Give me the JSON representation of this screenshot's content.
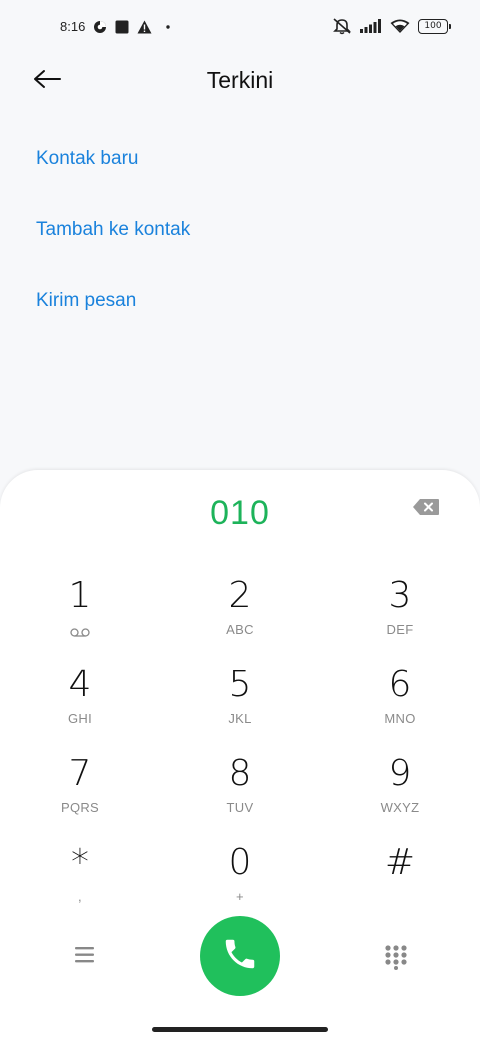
{
  "status_bar": {
    "time": "8:16",
    "battery": "100",
    "icons": [
      "data-saver-icon",
      "square-notification-icon",
      "warning-icon",
      "dot-icon",
      "muted-icon",
      "signal-icon",
      "wifi-icon",
      "battery-icon"
    ]
  },
  "header": {
    "title": "Terkini",
    "back_icon": "arrow-left-icon"
  },
  "actions": [
    {
      "label": "Kontak baru"
    },
    {
      "label": "Tambah ke kontak"
    },
    {
      "label": "Kirim pesan"
    }
  ],
  "dialer": {
    "number": "010",
    "accent_color": "#1db35a",
    "keys": [
      {
        "digit": "1",
        "letters": ""
      },
      {
        "digit": "2",
        "letters": "ABC"
      },
      {
        "digit": "3",
        "letters": "DEF"
      },
      {
        "digit": "4",
        "letters": "GHI"
      },
      {
        "digit": "5",
        "letters": "JKL"
      },
      {
        "digit": "6",
        "letters": "MNO"
      },
      {
        "digit": "7",
        "letters": "PQRS"
      },
      {
        "digit": "8",
        "letters": "TUV"
      },
      {
        "digit": "9",
        "letters": "WXYZ"
      },
      {
        "digit": "*",
        "letters": ","
      },
      {
        "digit": "0",
        "letters": "+"
      },
      {
        "digit": "#",
        "letters": ""
      }
    ]
  },
  "colors": {
    "link": "#1a82dc",
    "call_button": "#20c05c"
  }
}
